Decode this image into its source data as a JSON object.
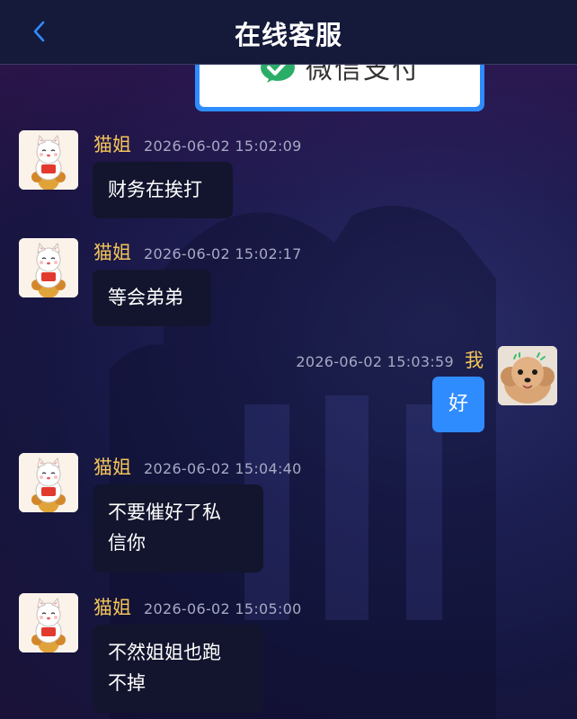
{
  "header": {
    "title": "在线客服",
    "back_icon": "chevron-left-icon"
  },
  "pay_card": {
    "label": "微信支付",
    "icon": "wechat-pay-icon",
    "accent": "#2f8cff"
  },
  "messages": [
    {
      "side": "left",
      "name": "猫姐",
      "time": "2026-06-02 15:02:09",
      "lines": [
        "财务在挨打"
      ]
    },
    {
      "side": "left",
      "name": "猫姐",
      "time": "2026-06-02 15:02:17",
      "lines": [
        "等会弟弟"
      ]
    },
    {
      "side": "right",
      "name": "我",
      "time": "2026-06-02 15:03:59",
      "lines": [
        "好"
      ]
    },
    {
      "side": "left",
      "name": "猫姐",
      "time": "2026-06-02 15:04:40",
      "lines": [
        "不要催好了私",
        "信你"
      ]
    },
    {
      "side": "left",
      "name": "猫姐",
      "time": "2026-06-02 15:05:00",
      "lines": [
        "不然姐姐也跑",
        "不掉"
      ]
    }
  ],
  "colors": {
    "name": "#f4c55a",
    "time": "#a7a9c4",
    "bubble_left": "#13152e",
    "bubble_right": "#2f8cff",
    "header_bg": "#151a3a"
  }
}
